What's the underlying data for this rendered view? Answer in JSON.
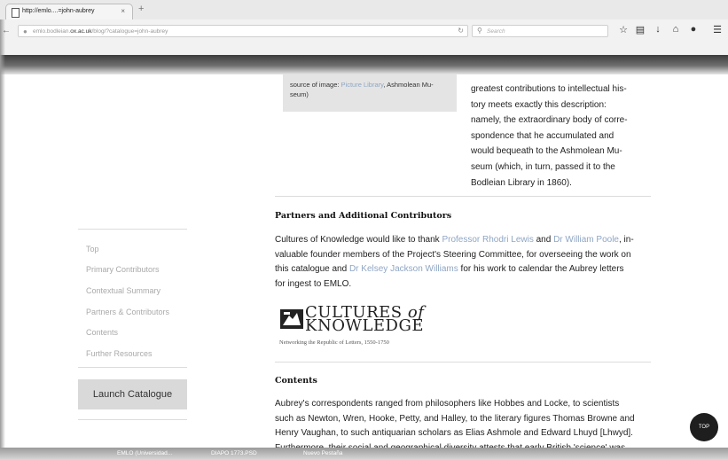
{
  "browser": {
    "tab_title": "http://emlo....=john-aubrey",
    "tab_close": "×",
    "new_tab": "+",
    "url_prefix": "emlo.bodleian.",
    "url_domain": "ox.ac.uk",
    "url_path": "/blog/?catalogue=john-aubrey",
    "search_placeholder": "Search"
  },
  "image_caption": {
    "prefix": "source of image:",
    "link": "Picture Library",
    "suffix": ", Ashmolean Mu-",
    "line2": "seum)"
  },
  "intro_lines": [
    "greatest contributions to intellectual his-",
    "tory meets exactly this description:",
    "namely, the extraordinary body of corre-",
    "spondence that he accumulated and",
    "would bequeath to the Ashmolean Mu-",
    "seum (which, in turn, passed it to the",
    "Bodleian Library in 1860)."
  ],
  "partners": {
    "title": "Partners and Additional Contributors",
    "l1_a": "Cultures of Knowledge would like to thank ",
    "l1_link1": "Professor Rhodri Lewis",
    "l1_b": " and ",
    "l1_link2": "Dr William Poole",
    "l1_c": ", in-",
    "l2": "valuable founder members of the Project's Steering Committee, for overseeing the work on",
    "l3_a": "this catalogue and ",
    "l3_link": "Dr Kelsey Jackson Williams",
    "l3_b": " for his work to calendar the Aubrey letters",
    "l4": "for ingest to EMLO."
  },
  "logo": {
    "word1": "CULTURES",
    "of": "of",
    "word2": "KNOWLEDGE",
    "tagline": "Networking the Republic of Letters, 1550-1750"
  },
  "contents": {
    "title": "Contents",
    "lines": [
      "Aubrey's correspondents ranged from philosophers like Hobbes and Locke, to scientists",
      "such as Newton, Wren, Hooke, Petty, and Halley, to the literary figures Thomas Browne and",
      "Henry Vaughan, to such  antiquarian scholars as Elias Ashmole and Edward Lhuyd [Lhwyd].",
      "Furthermore, their social and geographical diversity attests that early British 'science' was"
    ]
  },
  "sidebar": {
    "items": [
      "Top",
      "Primary Contributors",
      "Contextual Summary",
      "Partners & Contributors",
      "Contents",
      "Further Resources"
    ],
    "launch": "Launch Catalogue"
  },
  "top_button": "TOP",
  "taskbar": {
    "items": [
      "EMLO (Universidad...",
      "DIAPO 1773.PSD",
      "Nuevo Pestaña"
    ]
  }
}
